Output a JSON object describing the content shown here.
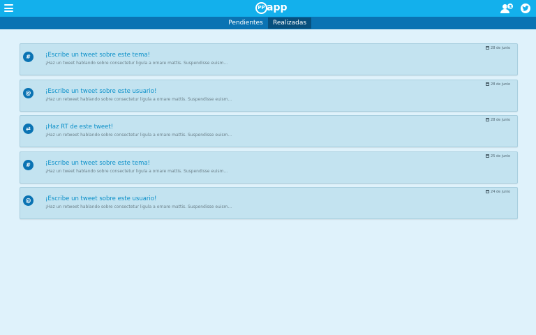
{
  "header": {
    "logo_pp": "PP",
    "logo_app": "app",
    "notification_count": "3"
  },
  "tabs": [
    {
      "label": "Pendientes",
      "active": false
    },
    {
      "label": "Realizadas",
      "active": true
    }
  ],
  "colors": {
    "topbar": "#13b0ec",
    "tabbar": "#0a73b3",
    "tab_active": "#07507e",
    "card_bg": "#c3e3f0",
    "title": "#0a8fc8"
  },
  "tasks": [
    {
      "icon": "hashtag-icon",
      "glyph": "#",
      "title": "¡Escribe un tweet sobre este tema!",
      "description": "¡Haz un tweet hablando sobre consectetur ligula a ornare mattis. Suspendisse euism...",
      "date": "28 de junio"
    },
    {
      "icon": "at-icon",
      "glyph": "@",
      "title": "¡Escribe un tweet sobre este usuario!",
      "description": "¡Haz un retweet hablando sobre consectetur ligula a ornare mattis. Suspendisse euism...",
      "date": "28 de junio"
    },
    {
      "icon": "retweet-icon",
      "glyph": "⇄",
      "title": "¡Haz RT de este tweet!",
      "description": "¡Haz un retweet hablando sobre consectetur ligula a ornare mattis. Suspendisse euism...",
      "date": "28 de junio"
    },
    {
      "icon": "hashtag-icon",
      "glyph": "#",
      "title": "¡Escribe un tweet sobre este tema!",
      "description": "¡Haz un tweet hablando sobre consectetur ligula a ornare mattis. Suspendisse euism...",
      "date": "25 de junio"
    },
    {
      "icon": "at-icon",
      "glyph": "@",
      "title": "¡Escribe un tweet sobre este usuario!",
      "description": "¡Haz un retweet hablando sobre consectetur ligula a ornare mattis. Suspendisse euism...",
      "date": "24 de junio"
    }
  ]
}
